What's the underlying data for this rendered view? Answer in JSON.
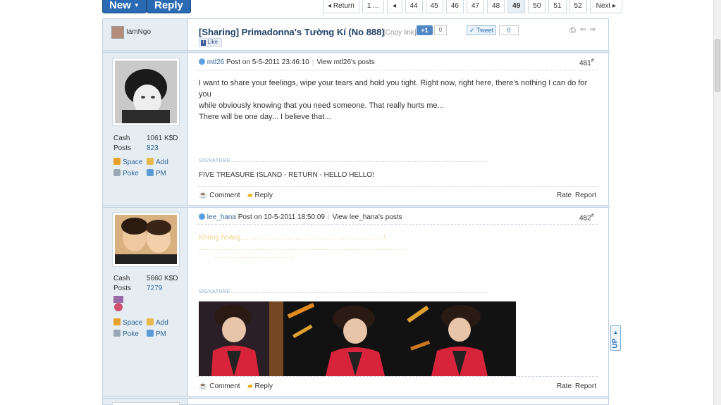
{
  "toolbar": {
    "new_label": "New",
    "reply_label": "Reply"
  },
  "pager": {
    "return_label": "Return",
    "first_label": "1 ...",
    "pages": [
      "44",
      "45",
      "46",
      "47",
      "48",
      "49",
      "50",
      "51",
      "52"
    ],
    "current_page": "49",
    "next_label": "Next"
  },
  "thread": {
    "author": "IamNgo",
    "title": "[Sharing] Primadonna's Tường Kí (No 888)",
    "copy_link_label": "[Copy link]",
    "plusone_label": "+1",
    "plusone_count": "0",
    "tweet_label": "Tweet",
    "tweet_count": "0",
    "fb_like_label": "Like"
  },
  "posts": [
    {
      "author": "mtl26",
      "meta_prefix": "Post on 5-5-2011 23:46:10",
      "view_posts": "View mtl26's posts",
      "floor": "481",
      "cash_label": "Cash",
      "cash_value": "1061 K$D",
      "posts_label": "Posts",
      "posts_value": "823",
      "space_label": "Space",
      "add_label": "Add",
      "poke_label": "Poke",
      "pm_label": "PM",
      "body_lines": [
        "I want to share your feelings, wipe your tears and hold you tight. Right now, right here, there's nothing I can do for you",
        "while obviously knowing that you need someone. That really hurts me...",
        "There will be one day... I believe that..."
      ],
      "signature_label": "SIGNATURE",
      "signature_text": "FIVE TREASURE ISLAND - RETURN - HELLO HELLO!",
      "comment_label": "Comment",
      "reply_label": "Reply",
      "rate_label": "Rate",
      "report_label": "Report"
    },
    {
      "author": "lee_hana",
      "meta_prefix": "Post on 10-5-2011 18:50:09",
      "view_posts": "View lee_hana's posts",
      "floor": "482",
      "cash_label": "Cash",
      "cash_value": "5660 K$D",
      "posts_label": "Posts",
      "posts_value": "7279",
      "space_label": "Space",
      "add_label": "Add",
      "poke_label": "Poke",
      "pm_label": "PM",
      "body_line": "Khủng hoảng.........................................................................!",
      "signature_label": "SIGNATURE",
      "comment_label": "Comment",
      "reply_label": "Reply",
      "rate_label": "Rate",
      "report_label": "Report"
    }
  ],
  "side_widget": {
    "up_label": "UP"
  },
  "colors": {
    "accent": "#2a6ab3",
    "sidebar": "#e5edf2",
    "link": "#336699",
    "title": "#1f3f66"
  }
}
